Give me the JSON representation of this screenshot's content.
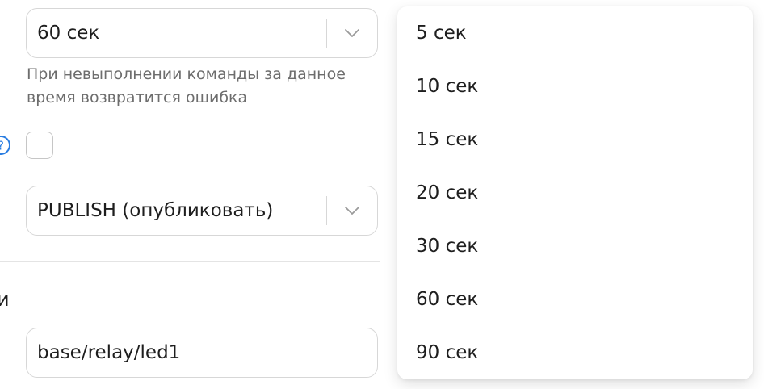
{
  "form": {
    "timeout": {
      "value": "60 сек",
      "hint": "При невыполнении команды за данное время возвратится ошибка"
    },
    "method": {
      "value": "PUBLISH (опубликовать)"
    },
    "section_label": "и",
    "topic": {
      "value": "base/relay/led1"
    }
  },
  "dropdown": {
    "options": [
      "5 сек",
      "10 сек",
      "15 сек",
      "20 сек",
      "30 сек",
      "60 сек",
      "90 сек"
    ]
  },
  "icons": {
    "help": "question-circle-icon",
    "arrow": "chevron-down-icon"
  },
  "colors": {
    "accent": "#2a7de1",
    "border": "#d7d7d7",
    "hint_text": "#6d6d6d"
  }
}
